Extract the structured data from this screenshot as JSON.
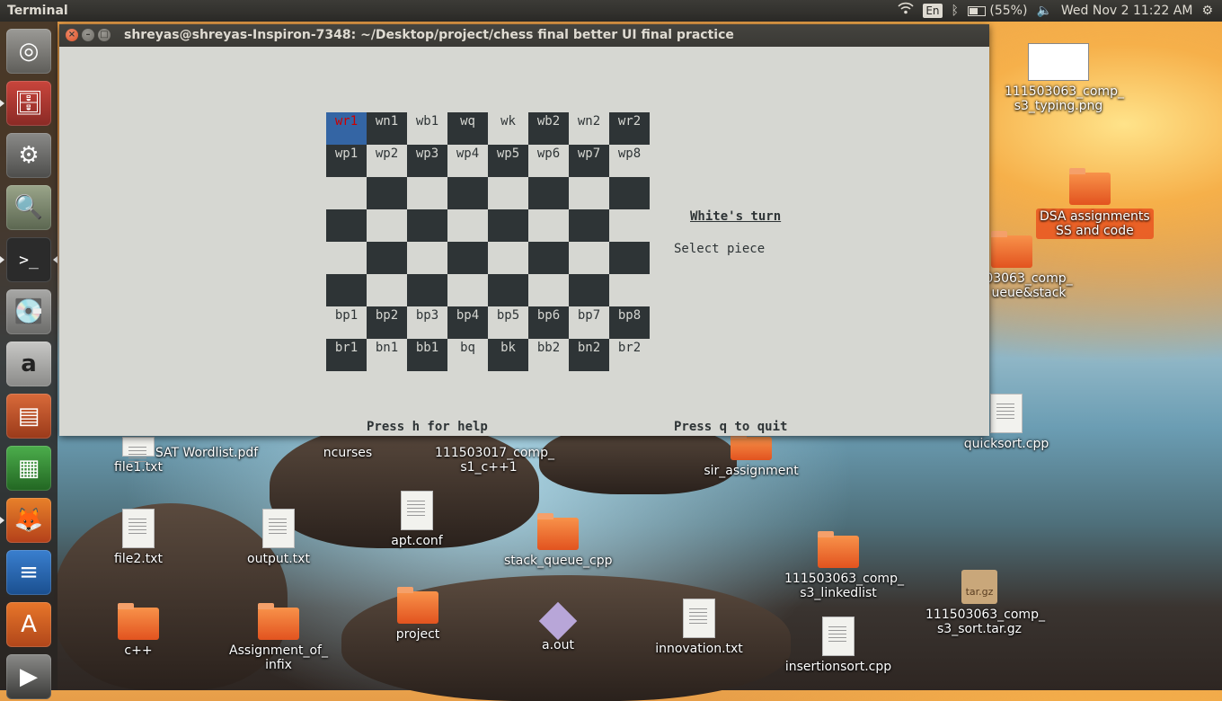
{
  "topbar": {
    "app_title": "Terminal",
    "keyboard": "En",
    "battery": "(55%)",
    "datetime": "Wed Nov 2 11:22 AM",
    "icons": [
      "wifi-icon",
      "bluetooth-icon",
      "battery-icon",
      "volume-icon",
      "power-gear-icon"
    ]
  },
  "launcher": {
    "items": [
      "ubuntu-dash-icon",
      "files-icon",
      "system-settings-icon",
      "image-viewer-icon",
      "terminal-icon",
      "disk-icon",
      "amazon-icon",
      "impress-icon",
      "calc-icon",
      "firefox-icon",
      "writer-icon",
      "software-center-icon",
      "video-icon"
    ]
  },
  "window": {
    "title": "shreyas@shreyas-Inspiron-7348: ~/Desktop/project/chess final  better UI final practice"
  },
  "chess": {
    "rows": [
      [
        "wr1",
        "wn1",
        "wb1",
        "wq",
        "wk",
        "wb2",
        "wn2",
        "wr2"
      ],
      [
        "wp1",
        "wp2",
        "wp3",
        "wp4",
        "wp5",
        "wp6",
        "wp7",
        "wp8"
      ],
      [
        "",
        "",
        "",
        "",
        "",
        "",
        "",
        ""
      ],
      [
        "",
        "",
        "",
        "",
        "",
        "",
        "",
        ""
      ],
      [
        "",
        "",
        "",
        "",
        "",
        "",
        "",
        ""
      ],
      [
        "",
        "",
        "",
        "",
        "",
        "",
        "",
        ""
      ],
      [
        "bp1",
        "bp2",
        "bp3",
        "bp4",
        "bp5",
        "bp6",
        "bp7",
        "bp8"
      ],
      [
        "br1",
        "bn1",
        "bb1",
        "bq",
        "bk",
        "bb2",
        "bn2",
        "br2"
      ]
    ],
    "selected": "wr1",
    "turn": "White's turn",
    "status": "Select piece",
    "help": "Press h for help",
    "quit": "Press q to quit"
  },
  "desktop": {
    "png_file": "111503063_comp_\ns3_typing.png",
    "dsa": "DSA assignments\nSS and code",
    "queue_stack": "03063_comp_\nueue&stack",
    "quicksort": "quicksort.cpp",
    "sat": "SAT Wordlist.pdf",
    "file1": "file1.txt",
    "ncurses": "ncurses",
    "comp_s1": "111503017_comp_\ns1_c++1",
    "sir": "sir_assignment",
    "file2": "file2.txt",
    "output": "output.txt",
    "aptconf": "apt.conf",
    "stack_queue": "stack_queue_cpp",
    "linkedlist": "111503063_comp_\ns3_linkedlist",
    "sort_tar": "111503063_comp_\ns3_sort.tar.gz",
    "tar_label": "tar.gz",
    "cpp": "c++",
    "infix": "Assignment_of_\ninfix",
    "project": "project",
    "aout": "a.out",
    "innovation": "innovation.txt",
    "insertionsort": "insertionsort.cpp"
  }
}
